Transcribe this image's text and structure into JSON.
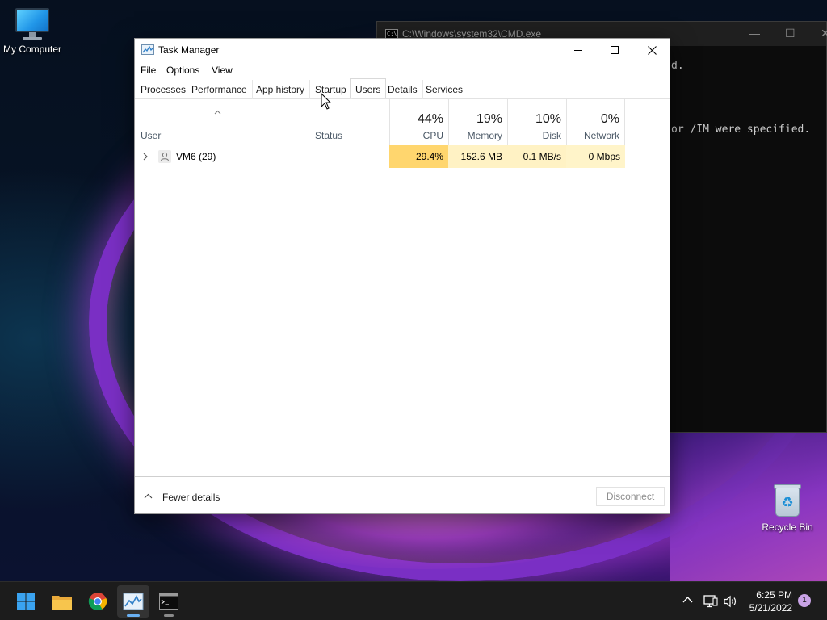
{
  "desktop": {
    "icons": [
      {
        "label": "My Computer",
        "icon": "computer-monitor-icon"
      },
      {
        "label": "Recycle Bin",
        "icon": "recycle-bin-icon"
      }
    ]
  },
  "cmd_window": {
    "title": "C:\\Windows\\system32\\CMD.exe",
    "lines": [
      "d.",
      "or /IM were specified."
    ]
  },
  "task_manager": {
    "title": "Task Manager",
    "menu": [
      "File",
      "Options",
      "View"
    ],
    "tabs": [
      "Processes",
      "Performance",
      "App history",
      "Startup",
      "Users",
      "Details",
      "Services"
    ],
    "active_tab": "Users",
    "columns": {
      "user": "User",
      "status": "Status",
      "cpu": {
        "label": "CPU",
        "percent": "44%"
      },
      "memory": {
        "label": "Memory",
        "percent": "19%"
      },
      "disk": {
        "label": "Disk",
        "percent": "10%"
      },
      "network": {
        "label": "Network",
        "percent": "0%"
      }
    },
    "rows": [
      {
        "user": "VM6 (29)",
        "status": "",
        "cpu": "29.4%",
        "memory": "152.6 MB",
        "disk": "0.1 MB/s",
        "network": "0 Mbps"
      }
    ],
    "heat_colors": {
      "cpu": "#ffd66e",
      "memory": "#fff2c4",
      "disk": "#fff2c4",
      "network": "#fff4c9"
    },
    "footer": {
      "fewer_details": "Fewer details",
      "disconnect": "Disconnect"
    }
  },
  "taskbar": {
    "items": [
      "start-icon",
      "file-explorer-icon",
      "chrome-icon",
      "task-manager-icon",
      "cmd-icon"
    ],
    "tray_icons": [
      "chevron-up-icon",
      "network-icon",
      "volume-icon"
    ],
    "time": "6:25 PM",
    "date": "5/21/2022",
    "notification_count": "1"
  }
}
